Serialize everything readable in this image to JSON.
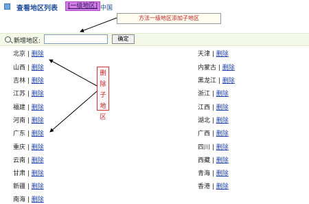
{
  "header": {
    "title": "查看地区列表",
    "link": "[一级地区]",
    "crumb": "中国"
  },
  "note_text": "方法一级地区添加子地区",
  "search": {
    "label": "新增地区:",
    "placeholder": "",
    "button_label": "确定"
  },
  "separator": "|",
  "delete_label": "删除",
  "vertical_note": "删除子地区",
  "regions": {
    "left": [
      "北京",
      "山西",
      "吉林",
      "江苏",
      "福建",
      "河南",
      "广东",
      "重庆",
      "云南",
      "甘肃",
      "新疆",
      "南海"
    ],
    "right": [
      "天津",
      "内蒙古",
      "黑龙江",
      "浙江",
      "江西",
      "湖北",
      "广西",
      "四川",
      "西藏",
      "青海",
      "香港"
    ]
  }
}
